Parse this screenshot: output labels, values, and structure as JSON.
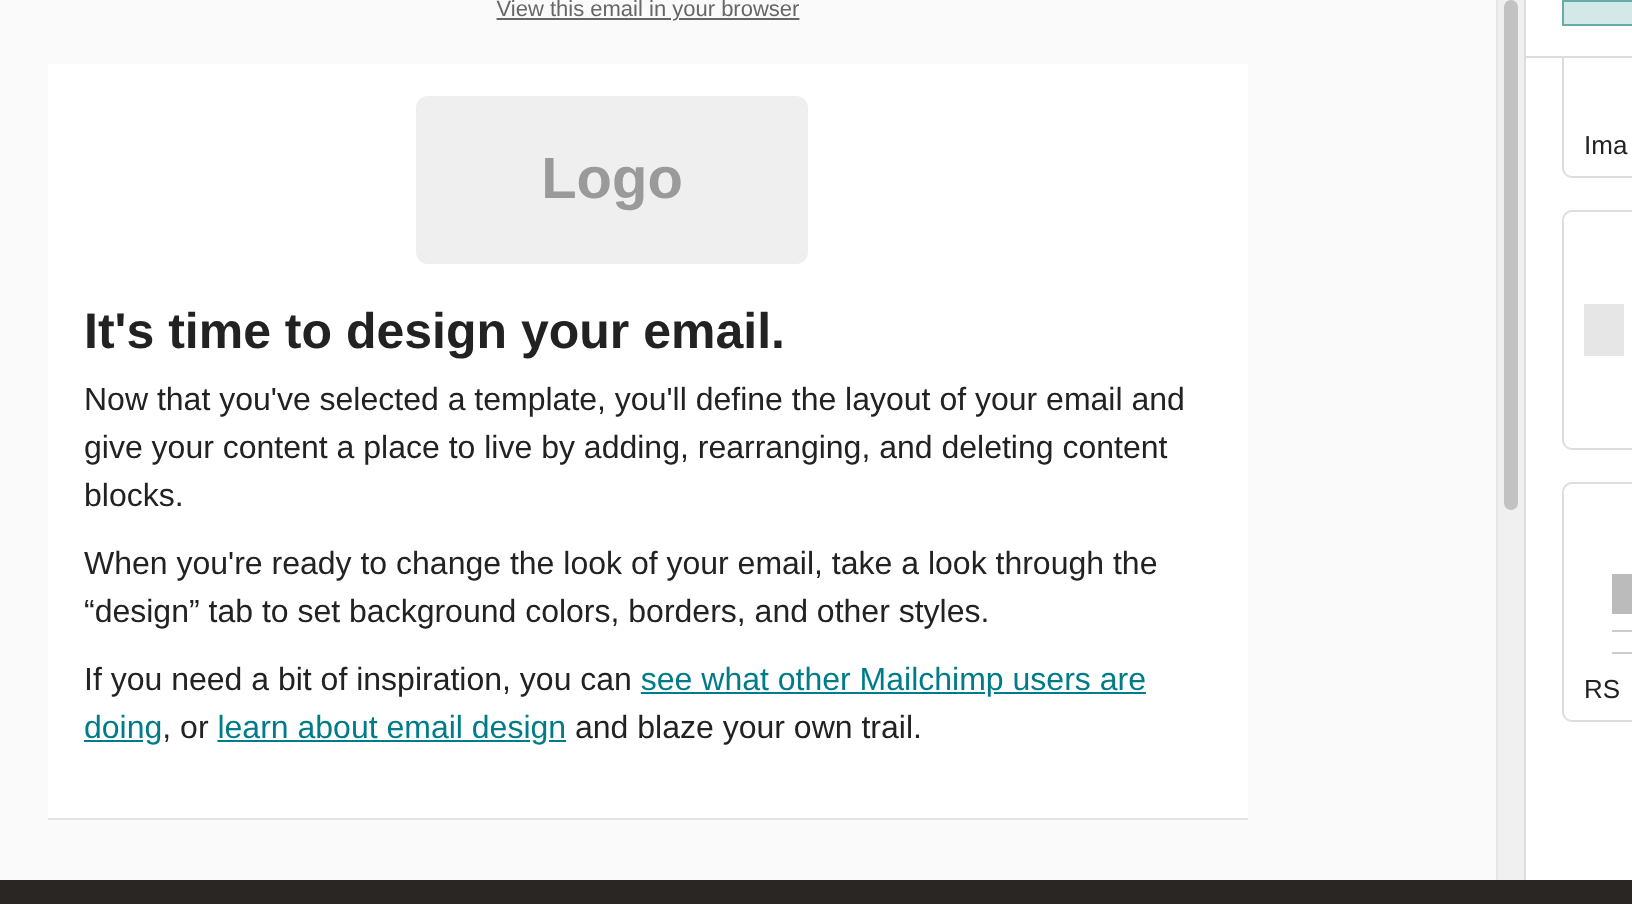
{
  "browser_link": "View this email in your browser",
  "email": {
    "logo": "Logo",
    "heading": "It's time to design your email.",
    "paragraphs": [
      [
        {
          "kind": "text",
          "text": "Now that you've selected a template, you'll define the layout of your email and give your content a place to live by adding, rearranging, and deleting content blocks."
        }
      ],
      [
        {
          "kind": "text",
          "text": "When you're ready to change the look of your email, take a look through the “design” tab to set background colors, borders, and other styles."
        }
      ],
      [
        {
          "kind": "text",
          "text": "If you need a bit of inspiration, you can "
        },
        {
          "kind": "link",
          "text": "see what other Mailchimp users are"
        },
        {
          "kind": "space"
        },
        {
          "kind": "link",
          "text": "doing"
        },
        {
          "kind": "text",
          "text": ", or "
        },
        {
          "kind": "link",
          "text": "learn about email design"
        },
        {
          "kind": "text",
          "text": " and blaze your own trail."
        }
      ]
    ]
  },
  "sidebar": {
    "blocks": [
      {
        "kind": "image",
        "label": "Ima"
      },
      {
        "kind": "plain"
      },
      {
        "kind": "rss",
        "label": "RS"
      }
    ]
  }
}
